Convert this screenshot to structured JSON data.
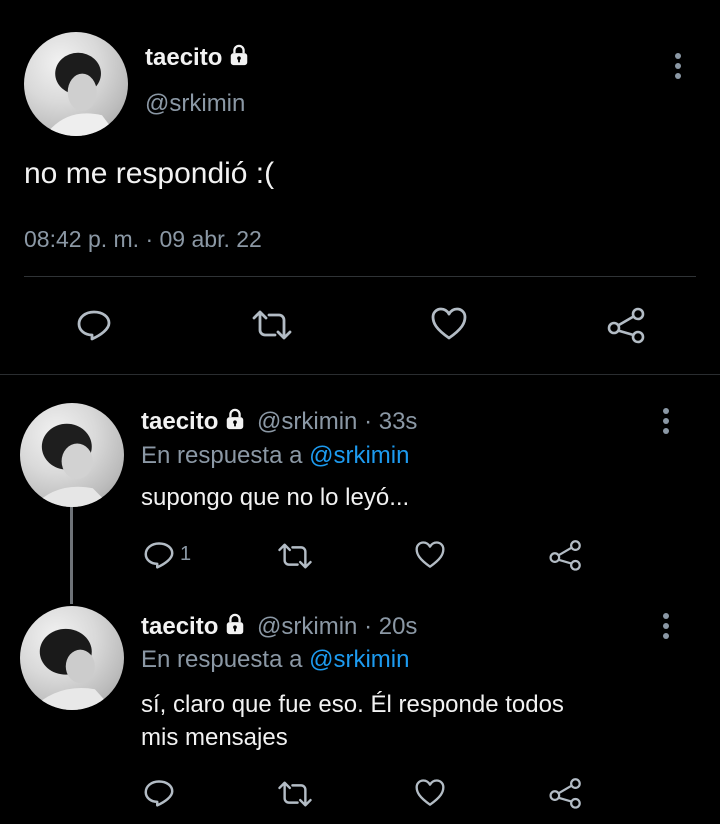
{
  "main_tweet": {
    "display_name": "taecito",
    "handle": "@srkimin",
    "text": "no me respondió :(",
    "timestamp": "08:42 p. m. · 09 abr. 22"
  },
  "replies": [
    {
      "display_name": "taecito",
      "handle": "@srkimin",
      "age": "· 33s",
      "reply_prefix": "En respuesta a",
      "reply_to": "@srkimin",
      "text": "supongo que no lo leyó...",
      "reply_count": "1"
    },
    {
      "display_name": "taecito",
      "handle": "@srkimin",
      "age": "· 20s",
      "reply_prefix": "En respuesta a",
      "reply_to": "@srkimin",
      "text_line1": "sí, claro que fue eso. Él responde todos",
      "text_line2": "mis mensajes"
    }
  ],
  "icons": [
    "lock-icon",
    "more-options-icon",
    "reply-icon",
    "retweet-icon",
    "like-icon",
    "share-icon"
  ],
  "colors": {
    "background": "#000000",
    "link": "#1d9bf0",
    "muted": "#8b98a5"
  }
}
